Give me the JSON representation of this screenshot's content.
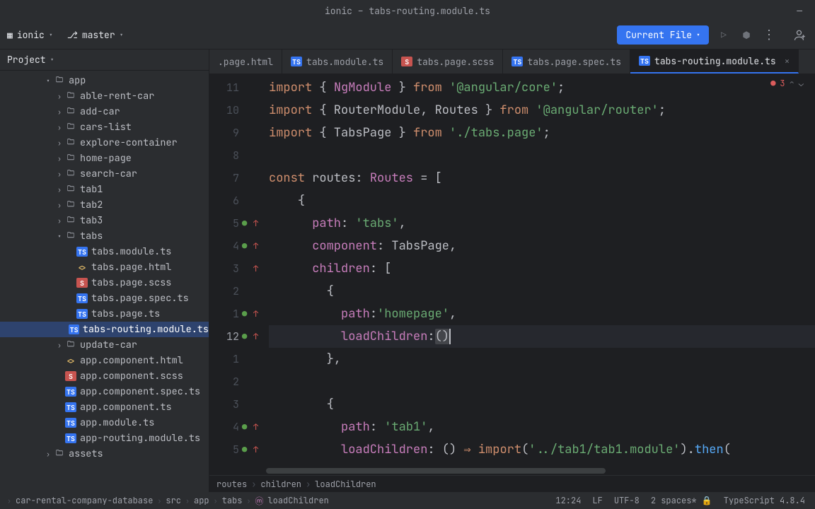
{
  "window": {
    "title": "ionic – tabs-routing.module.ts"
  },
  "nav": {
    "project": "ionic",
    "branch": "master",
    "run_config": "Current File"
  },
  "sidebar": {
    "header": "Project",
    "tree": [
      {
        "depth": 2,
        "arrow": "v",
        "icon": "folder",
        "label": "app"
      },
      {
        "depth": 3,
        "arrow": ">",
        "icon": "folder",
        "label": "able-rent-car"
      },
      {
        "depth": 3,
        "arrow": ">",
        "icon": "folder",
        "label": "add-car"
      },
      {
        "depth": 3,
        "arrow": ">",
        "icon": "folder",
        "label": "cars-list"
      },
      {
        "depth": 3,
        "arrow": ">",
        "icon": "folder",
        "label": "explore-container"
      },
      {
        "depth": 3,
        "arrow": ">",
        "icon": "folder",
        "label": "home-page"
      },
      {
        "depth": 3,
        "arrow": ">",
        "icon": "folder",
        "label": "search-car"
      },
      {
        "depth": 3,
        "arrow": ">",
        "icon": "folder",
        "label": "tab1"
      },
      {
        "depth": 3,
        "arrow": ">",
        "icon": "folder",
        "label": "tab2"
      },
      {
        "depth": 3,
        "arrow": ">",
        "icon": "folder",
        "label": "tab3"
      },
      {
        "depth": 3,
        "arrow": "v",
        "icon": "folder",
        "label": "tabs"
      },
      {
        "depth": 4,
        "arrow": "",
        "icon": "ts",
        "label": "tabs.module.ts"
      },
      {
        "depth": 4,
        "arrow": "",
        "icon": "html",
        "label": "tabs.page.html"
      },
      {
        "depth": 4,
        "arrow": "",
        "icon": "scss",
        "label": "tabs.page.scss"
      },
      {
        "depth": 4,
        "arrow": "",
        "icon": "ts",
        "label": "tabs.page.spec.ts"
      },
      {
        "depth": 4,
        "arrow": "",
        "icon": "ts",
        "label": "tabs.page.ts"
      },
      {
        "depth": 4,
        "arrow": "",
        "icon": "ts",
        "label": "tabs-routing.module.ts",
        "selected": true
      },
      {
        "depth": 3,
        "arrow": ">",
        "icon": "folder",
        "label": "update-car"
      },
      {
        "depth": 3,
        "arrow": "",
        "icon": "html",
        "label": "app.component.html"
      },
      {
        "depth": 3,
        "arrow": "",
        "icon": "scss",
        "label": "app.component.scss"
      },
      {
        "depth": 3,
        "arrow": "",
        "icon": "ts",
        "label": "app.component.spec.ts"
      },
      {
        "depth": 3,
        "arrow": "",
        "icon": "ts",
        "label": "app.component.ts"
      },
      {
        "depth": 3,
        "arrow": "",
        "icon": "ts",
        "label": "app.module.ts"
      },
      {
        "depth": 3,
        "arrow": "",
        "icon": "ts",
        "label": "app-routing.module.ts"
      },
      {
        "depth": 2,
        "arrow": ">",
        "icon": "folder",
        "label": "assets"
      }
    ]
  },
  "tabs": [
    {
      "icon": "",
      "label": ".page.html"
    },
    {
      "icon": "ts",
      "label": "tabs.module.ts"
    },
    {
      "icon": "scss",
      "label": "tabs.page.scss"
    },
    {
      "icon": "ts",
      "label": "tabs.page.spec.ts"
    },
    {
      "icon": "ts",
      "label": "tabs-routing.module.ts",
      "active": true,
      "closable": true
    }
  ],
  "errors": {
    "count": "3"
  },
  "gutter": [
    {
      "n": "11"
    },
    {
      "n": "10"
    },
    {
      "n": "9"
    },
    {
      "n": "8"
    },
    {
      "n": "7"
    },
    {
      "n": "6"
    },
    {
      "n": "5",
      "mark": "dot-up"
    },
    {
      "n": "4",
      "mark": "dot-up"
    },
    {
      "n": "3",
      "mark": "up"
    },
    {
      "n": "2"
    },
    {
      "n": "1",
      "mark": "dot-up"
    },
    {
      "n": "12",
      "mark": "dot-up",
      "current": true
    },
    {
      "n": "1"
    },
    {
      "n": "2"
    },
    {
      "n": "3"
    },
    {
      "n": "4",
      "mark": "dot-up"
    },
    {
      "n": "5",
      "mark": "dot-up"
    }
  ],
  "code": {
    "l1": {
      "a": "import",
      "b": "{ ",
      "c": "NgModule",
      "d": " }",
      "e": " from ",
      "f": "'@angular/core'",
      "g": ";"
    },
    "l2": {
      "a": "import",
      "b": "{ RouterModule, Routes }",
      "e": " from ",
      "f": "'@angular/router'",
      "g": ";"
    },
    "l3": {
      "a": "import",
      "b": "{ TabsPage }",
      "e": " from ",
      "f": "'./tabs.page'",
      "g": ";"
    },
    "l5": {
      "a": "const ",
      "b": "routes",
      "c": ": ",
      "d": "Routes",
      "e": " = ["
    },
    "l6": "    {",
    "l7": {
      "a": "      path",
      "b": ": ",
      "c": "'tabs'",
      "d": ","
    },
    "l8": {
      "a": "      component",
      "b": ": ",
      "c": "TabsPage",
      "d": ","
    },
    "l9": {
      "a": "      children",
      "b": ": ["
    },
    "l10": "        {",
    "l11": {
      "a": "          path",
      "b": ":",
      "c": "'homepage'",
      "d": ","
    },
    "l12": {
      "a": "          loadChildren",
      "b": ":",
      "c": "()"
    },
    "l13": "        },",
    "l15": "        {",
    "l16": {
      "a": "          path",
      "b": ": ",
      "c": "'tab1'",
      "d": ","
    },
    "l17": {
      "a": "          loadChildren",
      "b": ": () ",
      "c": "⇒",
      "d": " import",
      "e": "(",
      "f": "'../tab1/tab1.module'",
      "g": ").",
      "h": "then",
      "i": "("
    }
  },
  "crumb_editor": [
    "routes",
    "children",
    "loadChildren"
  ],
  "status": {
    "path": [
      "car-rental-company-database",
      "src",
      "app",
      "tabs",
      "loadChildren"
    ],
    "pos": "12:24",
    "le": "LF",
    "enc": "UTF-8",
    "indent": "2 spaces*",
    "lang": "TypeScript 4.8.4"
  }
}
